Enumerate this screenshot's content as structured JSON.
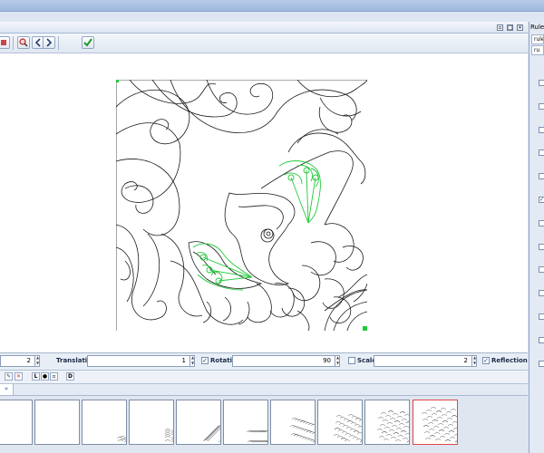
{
  "panel": {
    "title": "Rule l",
    "tab1": "rule",
    "tab2": "ru",
    "checkbox_states": [
      false,
      false,
      false,
      false,
      false,
      true,
      false,
      false,
      false,
      false,
      false,
      false,
      false
    ]
  },
  "toolbar": {
    "buttons": [
      "rule-icon",
      "search-zoom-icon",
      "previous-icon",
      "next-icon",
      "apply-check-icon"
    ]
  },
  "window_controls": [
    "restore-icon",
    "maximize-icon",
    "close-icon"
  ],
  "transform": {
    "first_value": "2",
    "translation_label": "Translation",
    "translation_value": "1",
    "rotation_label": "Rotation",
    "rotation_checked": true,
    "rotation_value": "90",
    "scale_label": "Scale",
    "scale_checked": false,
    "scale_value": "2",
    "reflection_label": "Reflection",
    "reflection_checked": true
  },
  "tools": {
    "labels": [
      "✎",
      "✕",
      "L",
      "●",
      "▫",
      "D"
    ]
  },
  "tabs": {
    "active_tab": "«"
  },
  "thumbnails": {
    "count": 10,
    "selected_index": 9
  },
  "colors": {
    "accent_green": "#22c93a",
    "selected_border": "#e0474c"
  }
}
